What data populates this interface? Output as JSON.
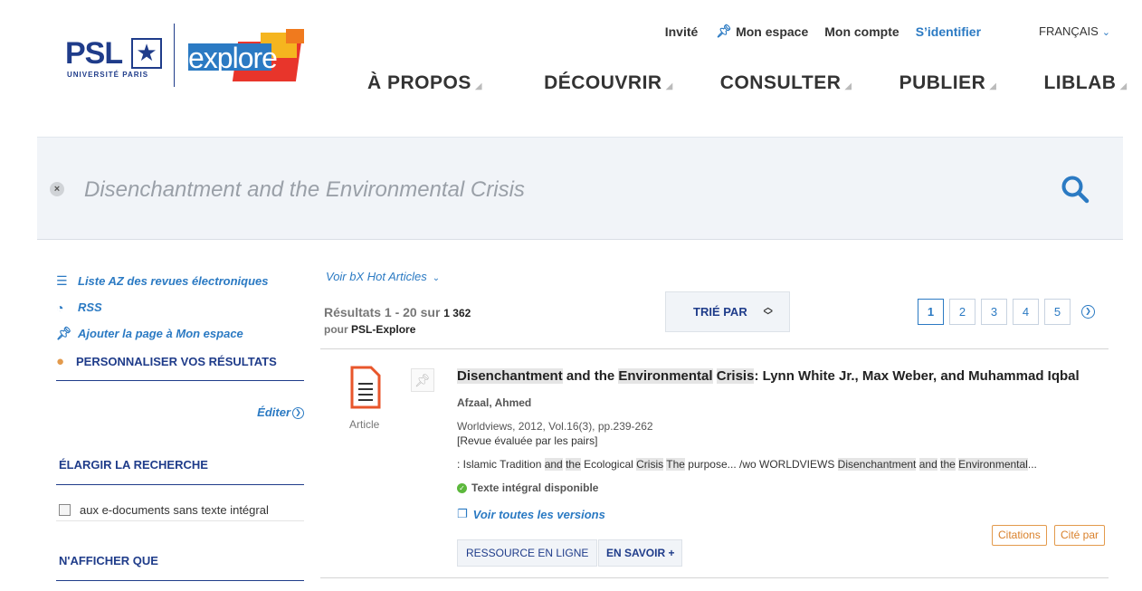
{
  "brand": {
    "psl": "PSL",
    "psl_sub": "UNIVERSITÉ PARIS",
    "explore": "explore"
  },
  "topnav": {
    "guest": "Invité",
    "my_space": "Mon espace",
    "my_account": "Mon compte",
    "login": "S’identifier",
    "language": "FRANÇAIS"
  },
  "mainnav": [
    "À PROPOS",
    "DÉCOUVRIR",
    "CONSULTER",
    "PUBLIER",
    "LIBLAB"
  ],
  "search": {
    "value": "Disenchantment and the Environmental Crisis"
  },
  "sidebar": {
    "az_list": "Liste AZ des revues électroniques",
    "rss": "RSS",
    "add_page": "Ajouter la page à Mon espace",
    "personalize": "PERSONNALISER VOS RÉSULTATS",
    "edit": "Éditer",
    "expand_title": "ÉLARGIR LA RECHERCHE",
    "expand_option": "aux e-documents sans texte intégral",
    "only_title": "N'AFFICHER QUE"
  },
  "results": {
    "hot_articles": "Voir bX Hot Articles",
    "count_prefix": "Résultats 1 - 20 sur",
    "total": "1 362",
    "scope_prefix": "pour",
    "scope": "PSL-Explore",
    "sort_label": "TRIÉ PAR",
    "pages": [
      "1",
      "2",
      "3",
      "4",
      "5"
    ]
  },
  "item": {
    "type": "Article",
    "title_parts": [
      {
        "text": "Disenchantment",
        "hl": true
      },
      {
        "text": " and the ",
        "hl": false
      },
      {
        "text": "Environmental",
        "hl": true
      },
      {
        "text": " ",
        "hl": false
      },
      {
        "text": "Crisis",
        "hl": true
      },
      {
        "text": ": Lynn White Jr., Max Weber, and Muhammad Iqbal",
        "hl": false
      }
    ],
    "author": "Afzaal, Ahmed",
    "publication": "Worldviews, 2012, Vol.16(3), pp.239-262",
    "peer_review": "[Revue évaluée par les pairs]",
    "snippet_parts": [
      {
        "text": ": Islamic Tradition ",
        "hl": false
      },
      {
        "text": "and",
        "hl": true
      },
      {
        "text": " ",
        "hl": false
      },
      {
        "text": "the",
        "hl": true
      },
      {
        "text": " Ecological ",
        "hl": false
      },
      {
        "text": "Crisis",
        "hl": true
      },
      {
        "text": " ",
        "hl": false
      },
      {
        "text": "The",
        "hl": true
      },
      {
        "text": " purpose... /wo WORLDVIEWS ",
        "hl": false
      },
      {
        "text": "Disenchantment",
        "hl": true
      },
      {
        "text": " ",
        "hl": false
      },
      {
        "text": "and",
        "hl": true
      },
      {
        "text": " ",
        "hl": false
      },
      {
        "text": "the",
        "hl": true
      },
      {
        "text": " ",
        "hl": false
      },
      {
        "text": "Environmental",
        "hl": true
      },
      {
        "text": "...",
        "hl": false
      }
    ],
    "availability": "Texte intégral disponible",
    "versions": "Voir toutes les versions",
    "online_resource": "RESSOURCE EN LIGNE",
    "learn_more": "EN SAVOIR +",
    "citations": "Citations",
    "cited_by": "Cité par"
  },
  "colors": {
    "accent": "#2b7ac3",
    "navy": "#1f3c8a",
    "orange": "#e39a4c"
  }
}
